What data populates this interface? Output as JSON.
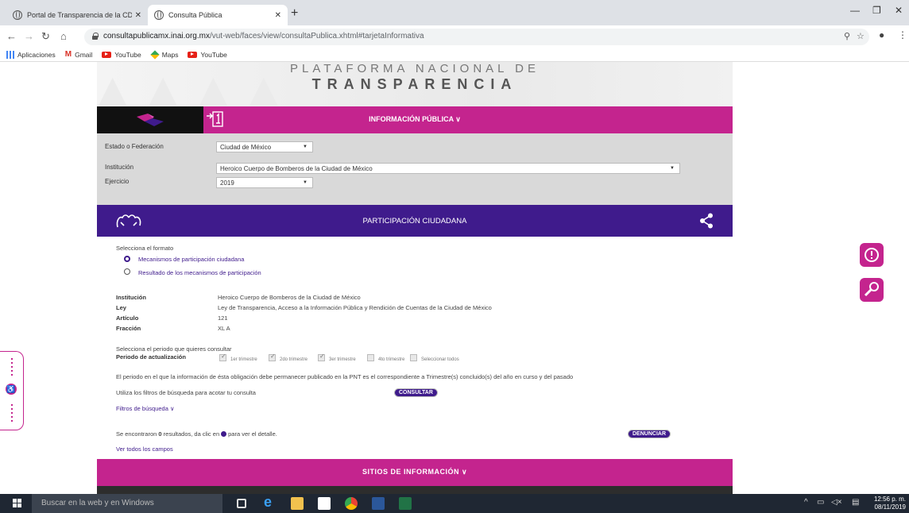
{
  "browser": {
    "tabs": [
      {
        "title": "Portal de Transparencia de la CDMX",
        "active": false
      },
      {
        "title": "Consulta Pública",
        "active": true
      }
    ],
    "url_host": "consultapublicamx.inai.org.mx",
    "url_path": "/vut-web/faces/view/consultaPublica.xhtml#tarjetaInformativa",
    "bookmarks": [
      "Aplicaciones",
      "Gmail",
      "YouTube",
      "Maps",
      "YouTube"
    ]
  },
  "banner": {
    "line1": "PLATAFORMA NACIONAL DE",
    "line2": "TRANSPARENCIA"
  },
  "infobar": {
    "label": "INFORMACIÓN PÚBLICA ∨"
  },
  "filters": {
    "estado_label": "Estado o Federación",
    "estado_value": "Ciudad de México",
    "institucion_label": "Institución",
    "institucion_value": "Heroico Cuerpo de Bomberos de la Ciudad de México",
    "ejercicio_label": "Ejercicio",
    "ejercicio_value": "2019"
  },
  "participacion": {
    "label": "PARTICIPACIÓN CIUDADANA"
  },
  "formato": {
    "prompt": "Selecciona el formato",
    "options": [
      {
        "label": "Mecanismos de participación ciudadana",
        "selected": true
      },
      {
        "label": "Resultado de los mecanismos de participación",
        "selected": false
      }
    ]
  },
  "details": {
    "institucion_label": "Institución",
    "institucion_value": "Heroico Cuerpo de Bomberos de la Ciudad de México",
    "ley_label": "Ley",
    "ley_value": "Ley de Transparencia, Acceso a la Información Pública y Rendición de Cuentas de la Ciudad de México",
    "articulo_label": "Artículo",
    "articulo_value": "121",
    "fraccion_label": "Fracción",
    "fraccion_value": "XL A"
  },
  "periodo": {
    "prompt": "Selecciona el periodo que quieres consultar",
    "label": "Periodo de actualización",
    "options": [
      {
        "label": "1er trimestre",
        "checked": true
      },
      {
        "label": "2do trimestre",
        "checked": true
      },
      {
        "label": "3er trimestre",
        "checked": true
      },
      {
        "label": "4to trimestre",
        "checked": false
      },
      {
        "label": "Seleccionar todos",
        "checked": false
      }
    ],
    "note": "El periodo en el que la información de ésta obligación debe permanecer publicado en la PNT es el correspondiente a Trimestre(s) concluido(s) del año en curso y del pasado"
  },
  "consulta": {
    "prompt": "Utiliza los filtros de búsqueda para acotar tu consulta",
    "button": "CONSULTAR",
    "filtros_link": "Filtros de búsqueda ∨",
    "results_pre": "Se encontraron",
    "results_count": "0",
    "results_post": "resultados, da clic en",
    "results_tail": "para ver el detalle.",
    "denunciar": "DENUNCIAR",
    "ver_todos": "Ver todos los campos"
  },
  "sitios": {
    "label": "SITIOS DE INFORMACIÓN ∨"
  },
  "taskbar": {
    "search_placeholder": "Buscar en la web y en Windows",
    "time": "12:56 p. m.",
    "date": "08/11/2019"
  },
  "colors": {
    "magenta": "#c4248e",
    "purple": "#3f1b8c"
  },
  "icons": [
    "world-icon",
    "lock-icon",
    "zoom-icon",
    "star-icon",
    "account-icon",
    "share-icon",
    "hands-icon",
    "login-icon",
    "alert-icon",
    "tools-icon",
    "accessibility-icon"
  ]
}
